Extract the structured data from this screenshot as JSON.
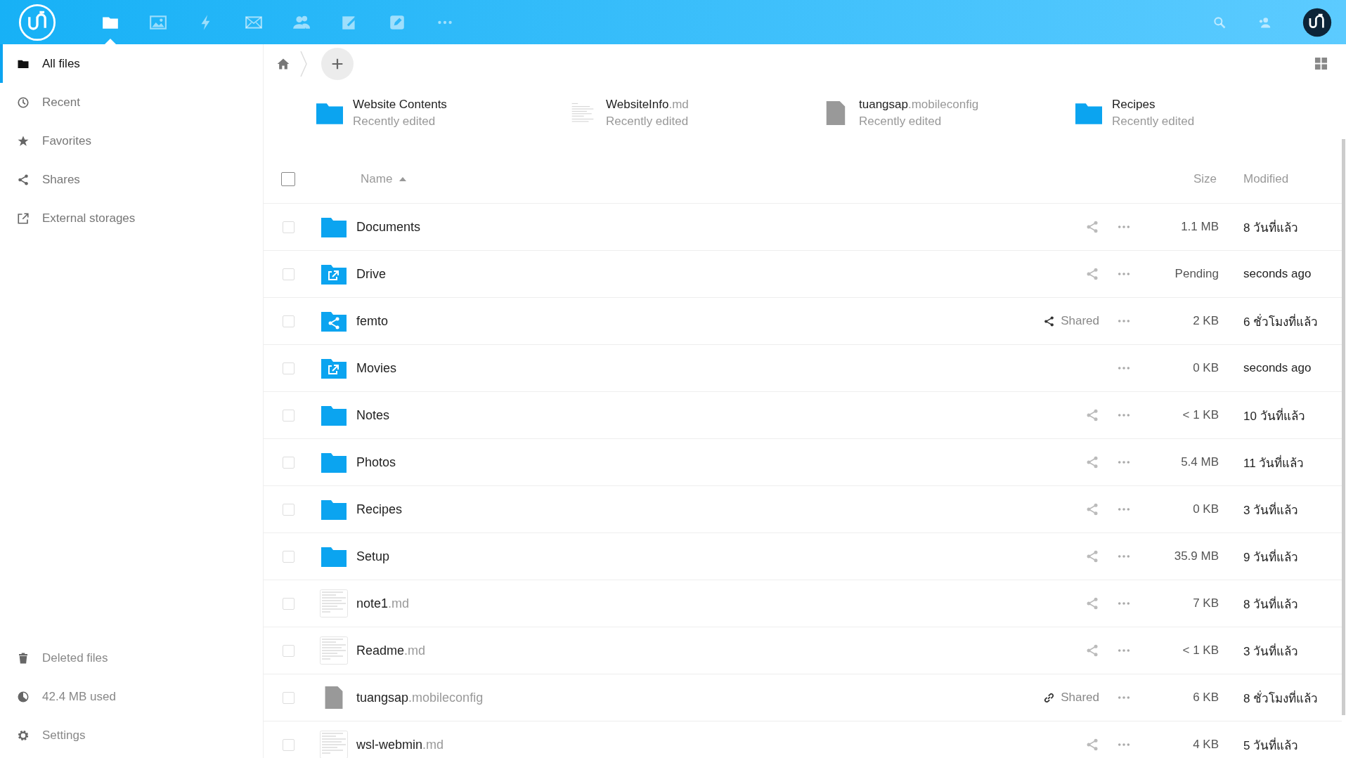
{
  "header": {
    "apps": [
      {
        "kind": "files",
        "selected": true
      },
      {
        "kind": "gallery",
        "selected": false
      },
      {
        "kind": "activity",
        "selected": false
      },
      {
        "kind": "mail",
        "selected": false
      },
      {
        "kind": "contacts",
        "selected": false
      },
      {
        "kind": "notes",
        "selected": false
      },
      {
        "kind": "edit",
        "selected": false
      },
      {
        "kind": "more",
        "selected": false
      }
    ]
  },
  "sidebar": {
    "items": [
      {
        "kind": "folder",
        "label": "All files",
        "selected": true
      },
      {
        "kind": "clock",
        "label": "Recent",
        "selected": false
      },
      {
        "kind": "star",
        "label": "Favorites",
        "selected": false
      },
      {
        "kind": "share",
        "label": "Shares",
        "selected": false
      },
      {
        "kind": "external",
        "label": "External storages",
        "selected": false
      }
    ],
    "bottom": [
      {
        "kind": "trash",
        "label": "Deleted files"
      },
      {
        "kind": "quota",
        "label": "42.4 MB used"
      },
      {
        "kind": "gear",
        "label": "Settings"
      }
    ]
  },
  "recent": [
    {
      "kind": "folder",
      "name": "Website Contents",
      "note": "Recently edited"
    },
    {
      "kind": "text",
      "name": "WebsiteInfo",
      "ext": ".md",
      "note": "Recently edited"
    },
    {
      "kind": "generic",
      "name": "tuangsap",
      "ext": ".mobileconfig",
      "note": "Recently edited"
    },
    {
      "kind": "folder",
      "name": "Recipes",
      "note": "Recently edited"
    }
  ],
  "table": {
    "select_all": {
      "checked": false
    },
    "columns": [
      "Name",
      "Size",
      "Modified"
    ],
    "rows": [
      {
        "kind": "folder",
        "name": "Documents",
        "share_icon": true,
        "size": "1.1 MB",
        "modified": "8 วันที่แล้ว",
        "checked": false
      },
      {
        "kind": "external",
        "name": "Drive",
        "share_icon": true,
        "size": "Pending",
        "modified": "seconds ago",
        "checked": false
      },
      {
        "kind": "shared",
        "name": "femto",
        "share_icon": false,
        "shared_label": "Shared",
        "link": false,
        "size": "2 KB",
        "modified": "6 ชั่วโมงที่แล้ว",
        "checked": false
      },
      {
        "kind": "external",
        "name": "Movies",
        "share_icon": false,
        "size": "0 KB",
        "modified": "seconds ago",
        "checked": false
      },
      {
        "kind": "folder",
        "name": "Notes",
        "share_icon": true,
        "size": "< 1 KB",
        "modified": "10 วันที่แล้ว",
        "checked": false
      },
      {
        "kind": "folder",
        "name": "Photos",
        "share_icon": true,
        "size": "5.4 MB",
        "modified": "11 วันที่แล้ว",
        "checked": false
      },
      {
        "kind": "folder",
        "name": "Recipes",
        "share_icon": true,
        "size": "0 KB",
        "modified": "3 วันที่แล้ว",
        "checked": false
      },
      {
        "kind": "folder",
        "name": "Setup",
        "share_icon": true,
        "size": "35.9 MB",
        "modified": "9 วันที่แล้ว",
        "checked": false
      },
      {
        "kind": "text",
        "name": "note1",
        "ext": ".md",
        "share_icon": true,
        "size": "7 KB",
        "modified": "8 วันที่แล้ว",
        "checked": false
      },
      {
        "kind": "text",
        "name": "Readme",
        "ext": ".md",
        "share_icon": true,
        "size": "< 1 KB",
        "modified": "3 วันที่แล้ว",
        "checked": false
      },
      {
        "kind": "generic",
        "name": "tuangsap",
        "ext": ".mobileconfig",
        "share_icon": false,
        "shared_label": "Shared",
        "link": true,
        "size": "6 KB",
        "modified": "8 ชั่วโมงที่แล้ว",
        "checked": false
      },
      {
        "kind": "text",
        "name": "wsl-webmin",
        "ext": ".md",
        "share_icon": true,
        "size": "4 KB",
        "modified": "5 วันที่แล้ว",
        "checked": false
      }
    ]
  }
}
